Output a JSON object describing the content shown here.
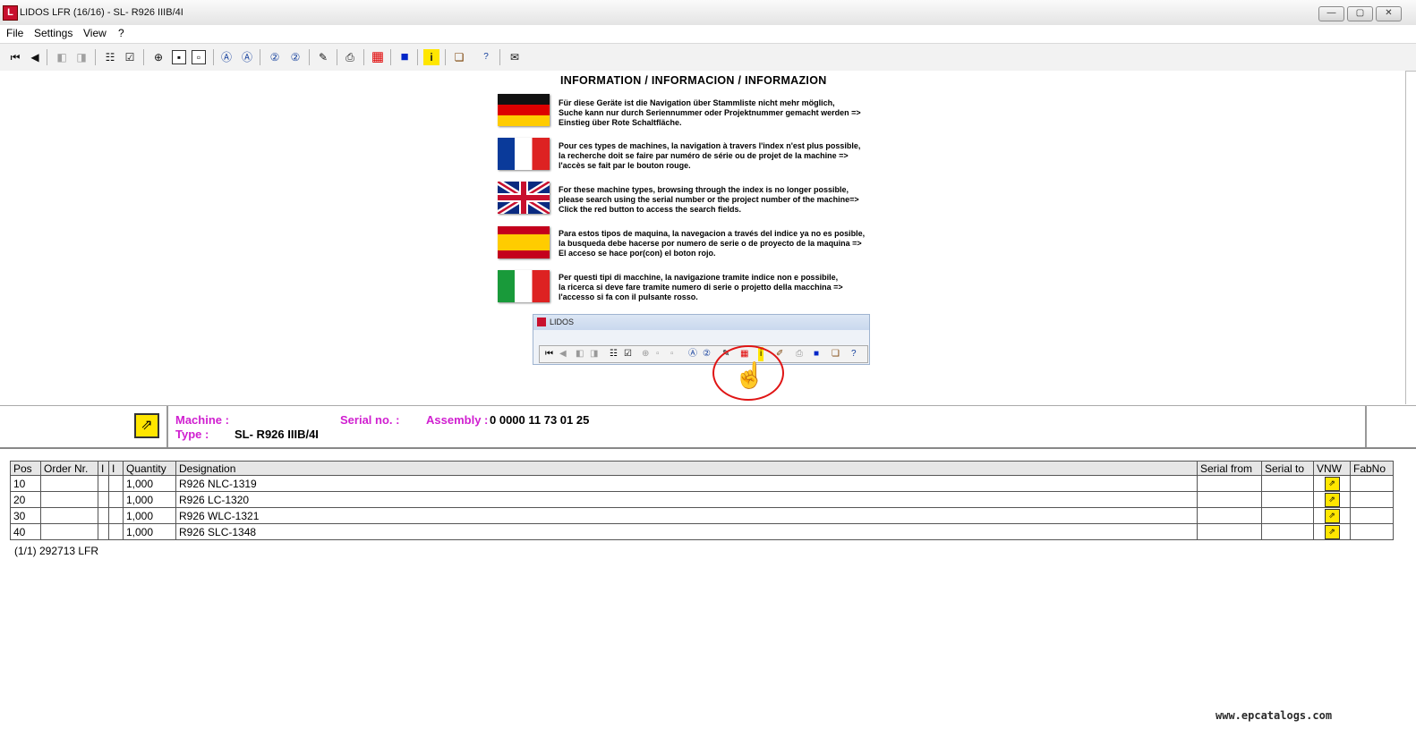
{
  "window": {
    "title": "LIDOS LFR (16/16) - SL- R926 IIIB/4I",
    "minimize": "—",
    "maximize": "▢",
    "close": "✕"
  },
  "menu": [
    "File",
    "Settings",
    "View",
    "?"
  ],
  "toolbar_icons": [
    "first-icon",
    "prev-icon",
    "back-doc-icon",
    "forward-doc-icon",
    "check-list-icon",
    "checked-doc-icon",
    "zoom-icon",
    "page-icon",
    "page2-icon",
    "search-a-icon",
    "search-a2-icon",
    "search-2-icon",
    "search-22-icon",
    "edit-icon",
    "print-icon",
    "grid-red-icon",
    "blue-square-icon",
    "info-icon",
    "book-icon",
    "lidos-help-icon",
    "mail-icon"
  ],
  "info": {
    "title": "INFORMATION / INFORMACION / INFORMAZION",
    "paragraphs": [
      {
        "flag": "de",
        "lines": [
          "Für diese Geräte ist die Navigation über Stammliste nicht mehr möglich,",
          "Suche kann nur durch Seriennummer oder Projektnummer gemacht werden =>",
          "Einstieg über Rote Schaltfläche."
        ]
      },
      {
        "flag": "fr",
        "lines": [
          "Pour ces types de machines, la navigation à travers l'index n'est plus possible,",
          "la recherche doit se faire par numéro de série ou de projet de la machine =>",
          "l'accès se fait par le bouton rouge."
        ]
      },
      {
        "flag": "uk",
        "lines": [
          "For these machine types, browsing through the index is no longer possible,",
          "please search using the serial number or the project number of the machine=>",
          "Click the red button to access the search fields."
        ]
      },
      {
        "flag": "es",
        "lines": [
          "Para estos tipos de maquina, la navegacion a través del indice ya no es posible,",
          "la busqueda debe hacerse por numero de serie o de proyecto de la maquina =>",
          "El acceso se hace por(con) el boton rojo."
        ]
      },
      {
        "flag": "it",
        "lines": [
          "Per questi tipi di macchine, la navigazione tramite indice non e possibile,",
          "la ricerca si deve fare tramite numero di serie o projetto della macchina =>",
          "l'accesso si fa con il pulsante rosso."
        ]
      }
    ],
    "mini_window_title": "LIDOS"
  },
  "header": {
    "machine_label": "Machine :",
    "serial_label": "Serial no. :",
    "assembly_label": "Assembly :",
    "assembly_value": "0 0000 11 73 01 25",
    "type_label": "Type :",
    "type_value": "SL- R926 IIIB/4I"
  },
  "table": {
    "columns": [
      "Pos",
      "Order Nr.",
      "I",
      "I",
      "Quantity",
      "Designation",
      "Serial from",
      "Serial to",
      "VNW",
      "FabNo"
    ],
    "rows": [
      {
        "pos": "10",
        "order": "",
        "q": "1,000",
        "designation": "R926 NLC-1319"
      },
      {
        "pos": "20",
        "order": "",
        "q": "1,000",
        "designation": "R926 LC-1320"
      },
      {
        "pos": "30",
        "order": "",
        "q": "1,000",
        "designation": "R926 WLC-1321"
      },
      {
        "pos": "40",
        "order": "",
        "q": "1,000",
        "designation": "R926 SLC-1348"
      }
    ]
  },
  "footer": "(1/1) 292713 LFR",
  "watermark": "www.epcatalogs.com",
  "colors": {
    "label_magenta": "#d01fd0",
    "jump_yellow": "#ffe600",
    "highlight_red": "#e01515"
  }
}
